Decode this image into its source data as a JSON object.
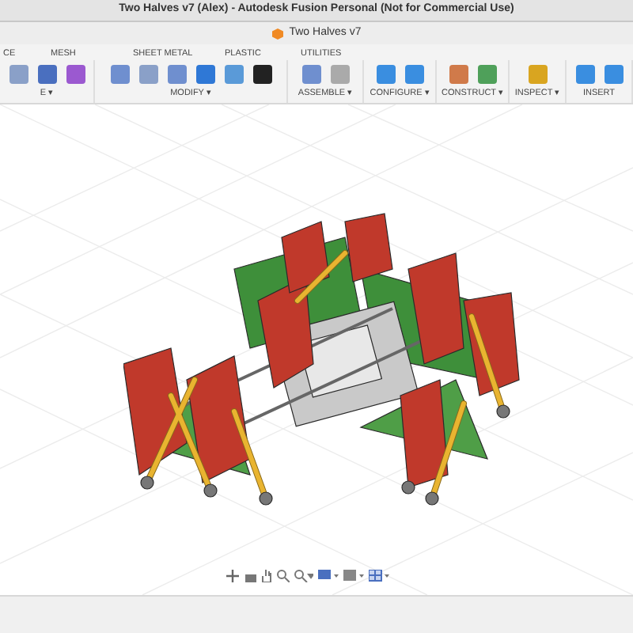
{
  "window": {
    "title": "Two Halves v7 (Alex) - Autodesk Fusion Personal (Not for Commercial Use)"
  },
  "document_tab": {
    "title": "Two Halves v7"
  },
  "tabs": [
    {
      "label": "CE"
    },
    {
      "label": "MESH"
    },
    {
      "label": "SHEET METAL"
    },
    {
      "label": "PLASTIC"
    },
    {
      "label": "UTILITIES"
    }
  ],
  "toolbar_groups": [
    {
      "label": "E ▾"
    },
    {
      "label": "MODIFY ▾"
    },
    {
      "label": "ASSEMBLE ▾"
    },
    {
      "label": "CONFIGURE ▾"
    },
    {
      "label": "CONSTRUCT ▾"
    },
    {
      "label": "INSPECT ▾"
    },
    {
      "label": "INSERT"
    }
  ]
}
